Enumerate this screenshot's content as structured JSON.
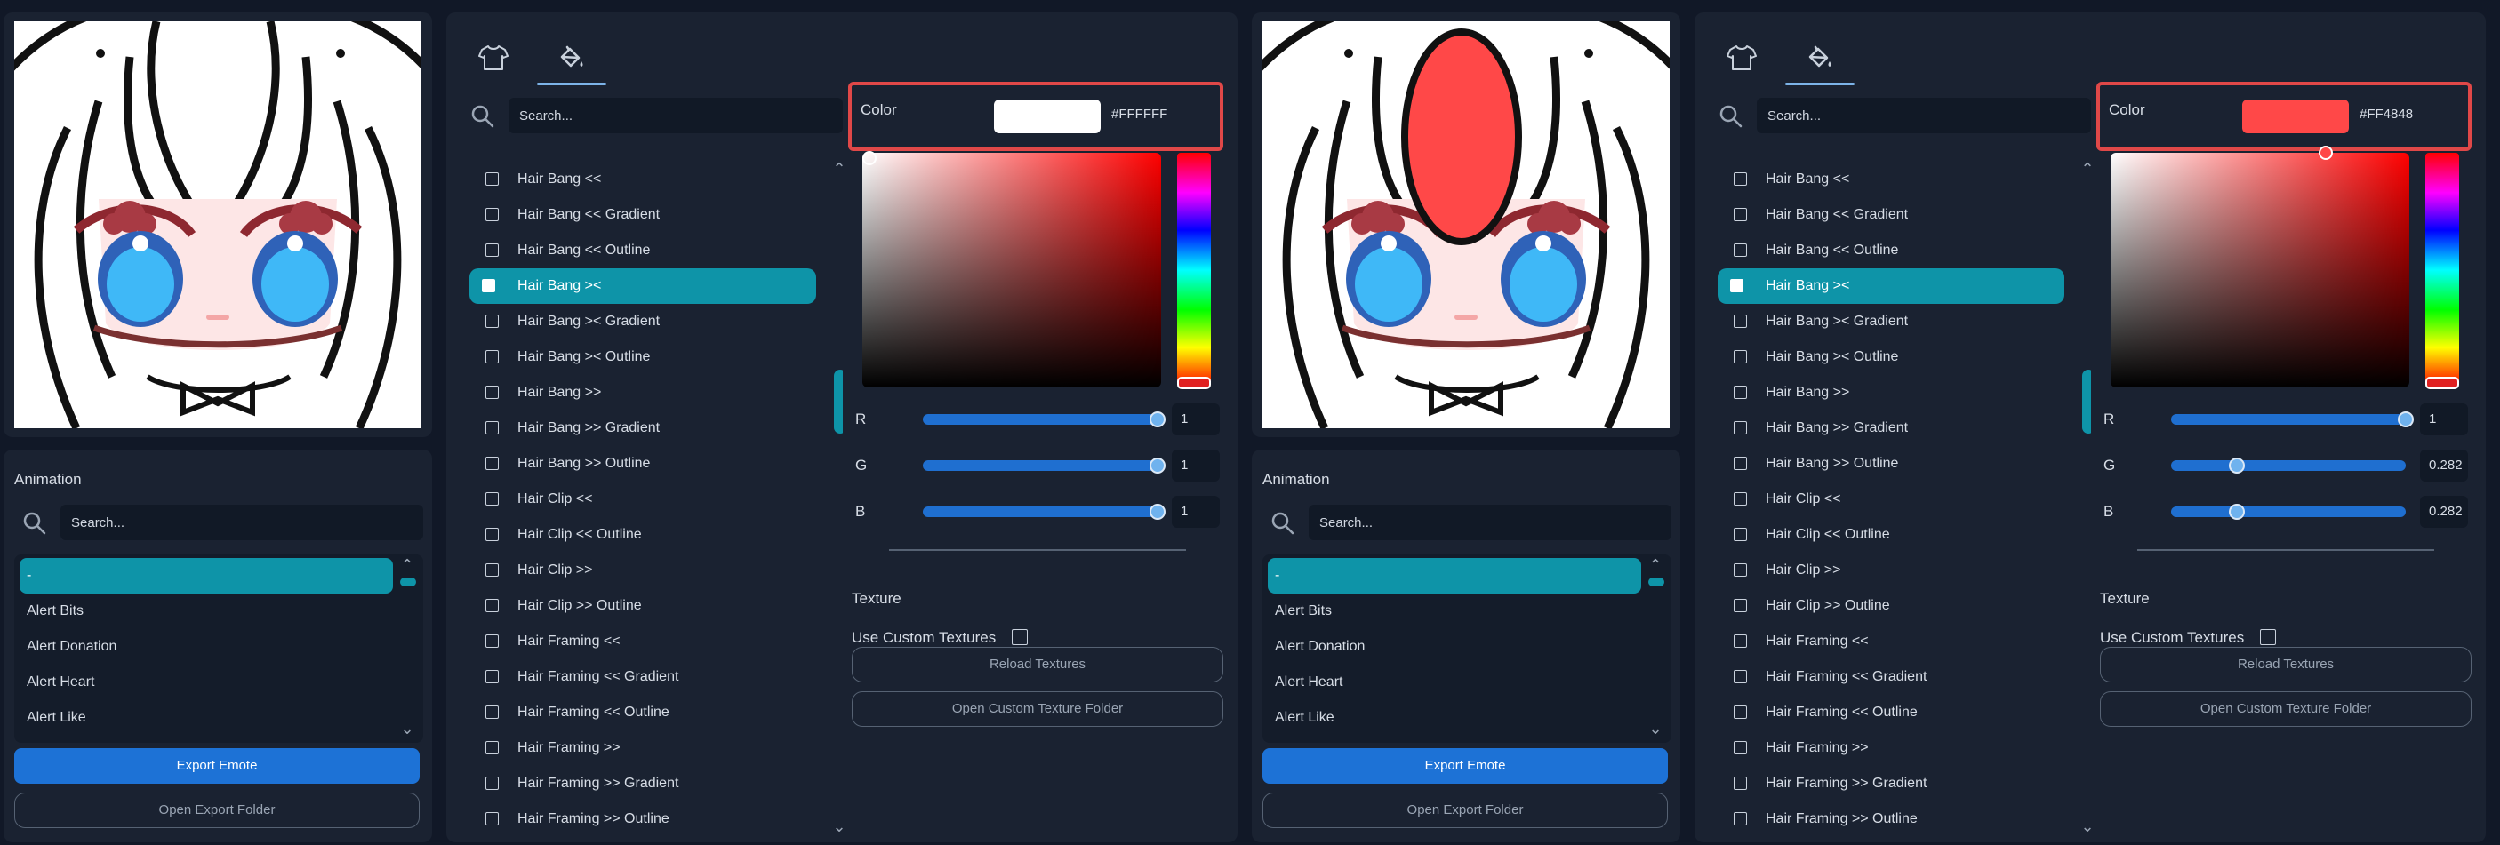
{
  "states": [
    {
      "emote": {
        "bang_fill": "none"
      },
      "animation": {
        "title": "Animation",
        "search_placeholder": "Search...",
        "items": [
          "-",
          "Alert Bits",
          "Alert Donation",
          "Alert Heart",
          "Alert Like"
        ],
        "export_label": "Export Emote",
        "open_folder_label": "Open Export Folder"
      },
      "editor": {
        "tabs": [
          {
            "icon": "shirt-icon"
          },
          {
            "icon": "paint-bucket-icon",
            "active": true
          }
        ],
        "search_placeholder": "Search...",
        "parts": [
          "Hair Bang <<",
          "Hair Bang << Gradient",
          "Hair Bang << Outline",
          "Hair Bang ><",
          "Hair Bang >< Gradient",
          "Hair Bang >< Outline",
          "Hair Bang >>",
          "Hair Bang >> Gradient",
          "Hair Bang >> Outline",
          "Hair Clip <<",
          "Hair Clip << Outline",
          "Hair Clip >>",
          "Hair Clip >> Outline",
          "Hair Framing <<",
          "Hair Framing << Gradient",
          "Hair Framing << Outline",
          "Hair Framing >>",
          "Hair Framing >> Gradient",
          "Hair Framing >> Outline"
        ],
        "selected_part": "Hair Bang ><",
        "color": {
          "label": "Color",
          "hex": "#FFFFFF",
          "swatch": "#ffffff"
        },
        "channels": [
          {
            "label": "R",
            "value": "1",
            "fraction": 1
          },
          {
            "label": "G",
            "value": "1",
            "fraction": 1
          },
          {
            "label": "B",
            "value": "1",
            "fraction": 1
          }
        ],
        "texture": {
          "title": "Texture",
          "use_custom_label": "Use Custom Textures",
          "use_custom": false,
          "reload_label": "Reload Textures",
          "open_folder_label": "Open Custom Texture Folder"
        }
      }
    },
    {
      "emote": {
        "bang_fill": "#ff4848"
      },
      "animation": {
        "title": "Animation",
        "search_placeholder": "Search...",
        "items": [
          "-",
          "Alert Bits",
          "Alert Donation",
          "Alert Heart",
          "Alert Like"
        ],
        "export_label": "Export Emote",
        "open_folder_label": "Open Export Folder"
      },
      "editor": {
        "tabs": [
          {
            "icon": "shirt-icon"
          },
          {
            "icon": "paint-bucket-icon",
            "active": true
          }
        ],
        "search_placeholder": "Search...",
        "parts": [
          "Hair Bang <<",
          "Hair Bang << Gradient",
          "Hair Bang << Outline",
          "Hair Bang ><",
          "Hair Bang >< Gradient",
          "Hair Bang >< Outline",
          "Hair Bang >>",
          "Hair Bang >> Gradient",
          "Hair Bang >> Outline",
          "Hair Clip <<",
          "Hair Clip << Outline",
          "Hair Clip >>",
          "Hair Clip >> Outline",
          "Hair Framing <<",
          "Hair Framing << Gradient",
          "Hair Framing << Outline",
          "Hair Framing >>",
          "Hair Framing >> Gradient",
          "Hair Framing >> Outline"
        ],
        "selected_part": "Hair Bang ><",
        "color": {
          "label": "Color",
          "hex": "#FF4848",
          "swatch": "#ff4848"
        },
        "channels": [
          {
            "label": "R",
            "value": "1",
            "fraction": 1
          },
          {
            "label": "G",
            "value": "0.282",
            "fraction": 0.282
          },
          {
            "label": "B",
            "value": "0.282",
            "fraction": 0.282
          }
        ],
        "texture": {
          "title": "Texture",
          "use_custom_label": "Use Custom Textures",
          "use_custom": false,
          "reload_label": "Reload Textures",
          "open_folder_label": "Open Custom Texture Folder"
        }
      }
    }
  ],
  "theme": {
    "accent": "#0e94a8",
    "primary_button": "#1d72d6",
    "highlight_border": "#e04848"
  }
}
